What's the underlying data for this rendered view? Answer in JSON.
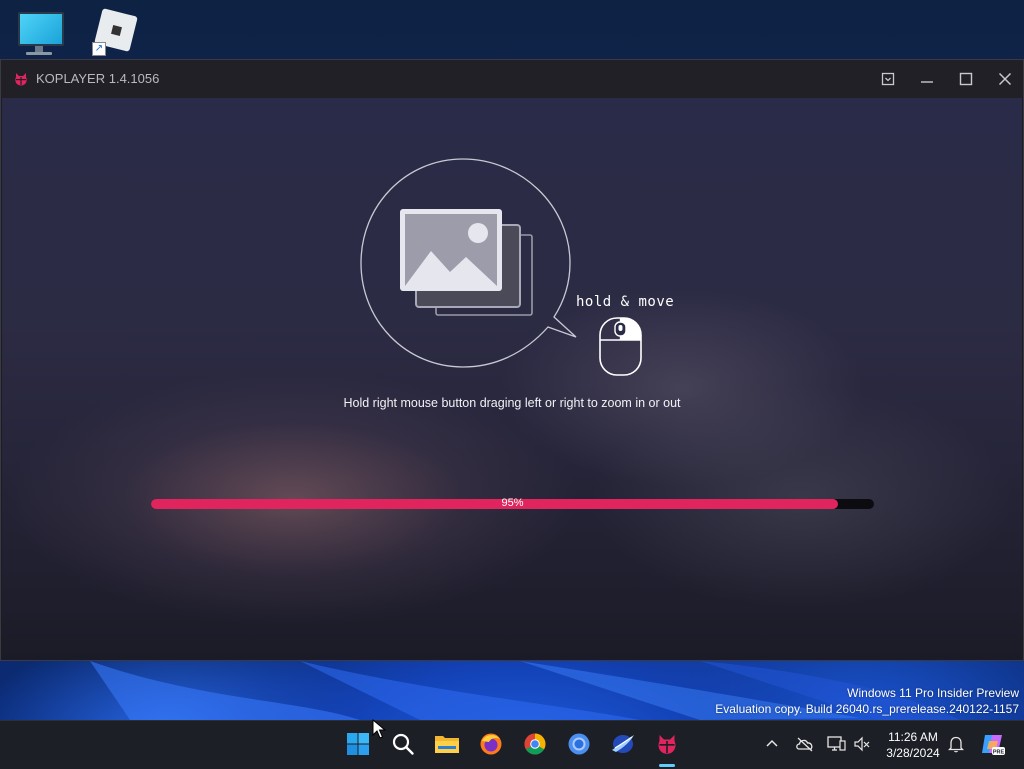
{
  "desktop": {
    "icons": [
      {
        "name": "this-pc",
        "icon": "monitor-icon"
      },
      {
        "name": "roblox-shortcut",
        "icon": "roblox-icon"
      }
    ]
  },
  "window": {
    "title": "KOPLAYER 1.4.1056",
    "accent_color": "#e0245e",
    "controls": [
      "dropdown-icon",
      "minimize-icon",
      "maximize-icon",
      "close-icon"
    ]
  },
  "loading": {
    "hint_label": "hold & move",
    "instruction": "Hold right mouse button draging left or right to zoom in or out",
    "progress_percent": 95,
    "progress_text": "95%"
  },
  "watermark": {
    "line1": "Windows 11 Pro Insider Preview",
    "line2": "Evaluation copy. Build 26040.rs_prerelease.240122-1157"
  },
  "taskbar": {
    "apps": [
      "start-icon",
      "search-icon",
      "file-explorer-icon",
      "firefox-icon",
      "chrome-icon",
      "chromium-icon",
      "koplayer-alt-icon",
      "koplayer-icon"
    ],
    "active_app": "koplayer-icon",
    "tray": [
      "chevron-up-icon",
      "onedrive-offline-icon",
      "display-icon",
      "volume-muted-icon",
      "notification-bell-icon",
      "copilot-icon"
    ],
    "clock_time": "11:26 AM",
    "clock_date": "3/28/2024"
  }
}
